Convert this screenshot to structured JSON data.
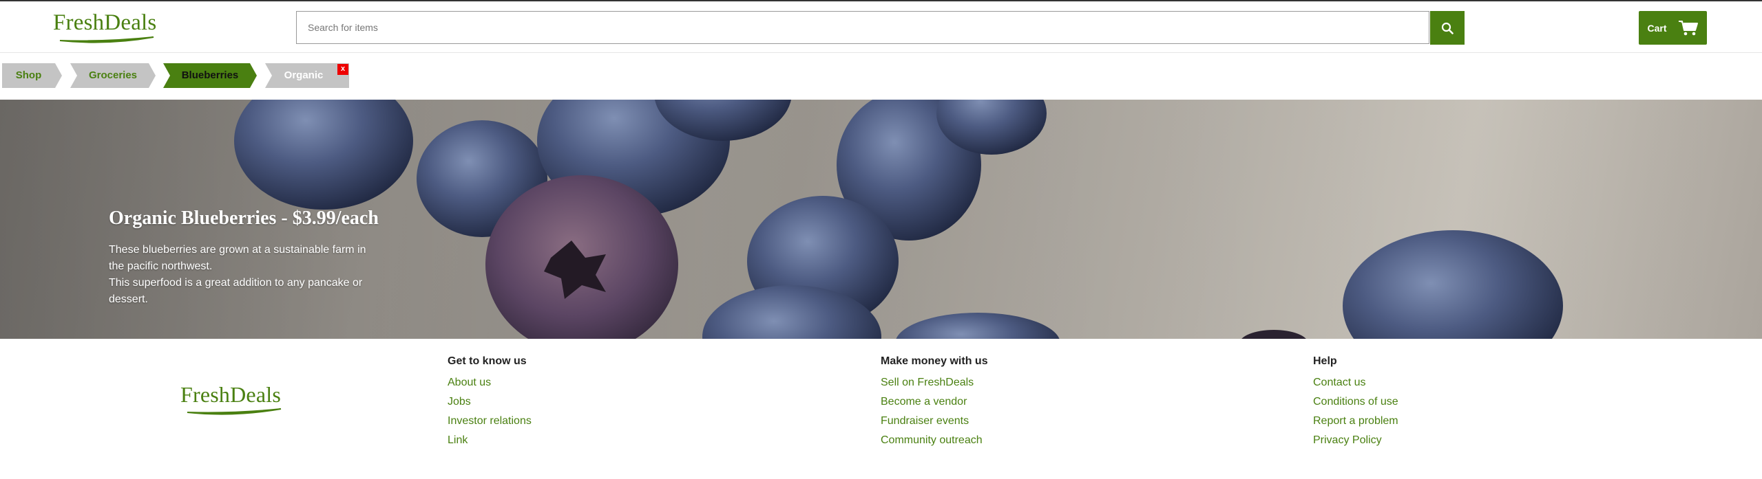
{
  "brand": {
    "name": "FreshDeals"
  },
  "search": {
    "placeholder": "Search for items"
  },
  "header": {
    "cart_label": "Cart"
  },
  "breadcrumb": {
    "items": [
      {
        "label": "Shop"
      },
      {
        "label": "Groceries"
      },
      {
        "label": "Blueberries"
      },
      {
        "label": "Organic"
      }
    ],
    "remove_label": "x"
  },
  "hero": {
    "title": "Organic Blueberries - $3.99/each",
    "description_1": "These blueberries are grown at a sustainable farm in the pacific northwest.",
    "description_2": "This superfood is a great addition to any pancake or dessert."
  },
  "footer": {
    "columns": [
      {
        "heading": "Get to know us",
        "links": [
          "About us",
          "Jobs",
          "Investor relations",
          "Link"
        ]
      },
      {
        "heading": "Make money with us",
        "links": [
          "Sell on FreshDeals",
          "Become a vendor",
          "Fundraiser events",
          "Community outreach"
        ]
      },
      {
        "heading": "Help",
        "links": [
          "Contact us",
          "Conditions of use",
          "Report a problem",
          "Privacy Policy"
        ]
      }
    ]
  },
  "colors": {
    "accent": "#4a8011",
    "crumb_inactive": "#c4c4c4",
    "close_badge": "#ee0000"
  },
  "icons": {
    "search": "search-icon",
    "cart": "cart-icon",
    "close": "close-icon"
  }
}
